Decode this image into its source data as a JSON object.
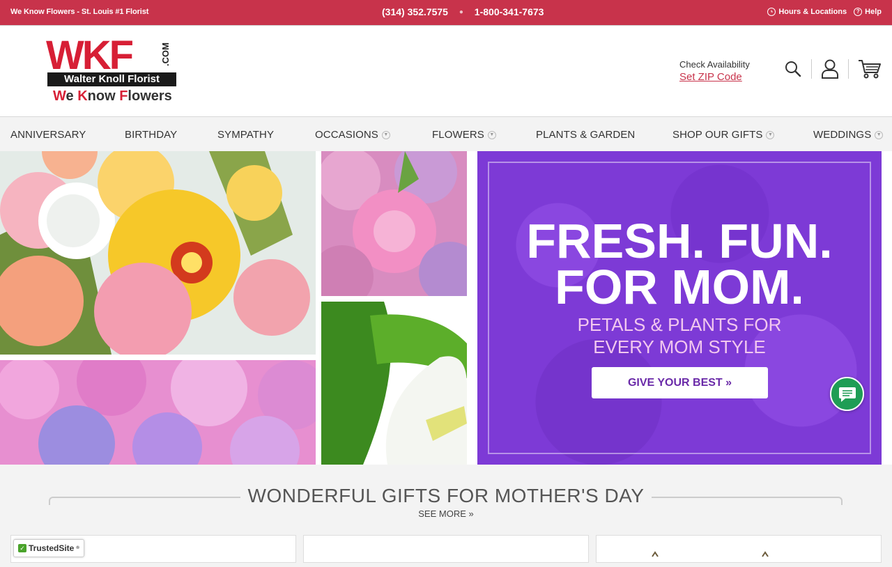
{
  "topbar": {
    "tagline": "We Know Flowers - St. Louis #1 Florist",
    "phone_local": "(314) 352.7575",
    "phone_toll": "1-800-341-7673",
    "hours_label": "Hours & Locations",
    "help_label": "Help"
  },
  "logo": {
    "letters": "WKF",
    "com": ".COM",
    "name": "Walter Knoll Florist",
    "slogan_parts": [
      "W",
      "e ",
      "K",
      "now ",
      "F",
      "lowers"
    ]
  },
  "header": {
    "check_label": "Check Availability",
    "zip_label": "Set ZIP Code",
    "icons": [
      "search-icon",
      "user-icon",
      "cart-icon"
    ]
  },
  "nav": {
    "items": [
      {
        "label": "ANNIVERSARY",
        "dropdown": false
      },
      {
        "label": "BIRTHDAY",
        "dropdown": false
      },
      {
        "label": "SYMPATHY",
        "dropdown": false
      },
      {
        "label": "OCCASIONS",
        "dropdown": true
      },
      {
        "label": "FLOWERS",
        "dropdown": true
      },
      {
        "label": "PLANTS & GARDEN",
        "dropdown": false
      },
      {
        "label": "SHOP OUR GIFTS",
        "dropdown": true
      },
      {
        "label": "WEDDINGS",
        "dropdown": true
      }
    ]
  },
  "promo": {
    "headline_1": "FRESH. FUN.",
    "headline_2": "FOR MOM.",
    "sub_1": "PETALS & PLANTS FOR",
    "sub_2": "EVERY MOM STYLE",
    "cta": "GIVE YOUR BEST »",
    "bg_color": "#7d3ad6"
  },
  "section": {
    "title": "WONDERFUL GIFTS FOR MOTHER'S DAY",
    "see_more": "SEE MORE »"
  },
  "badge": {
    "text": "TrustedSite"
  },
  "colors": {
    "brand_red": "#c8334b",
    "promo_purple": "#7d3ad6",
    "chat_green": "#1f9d55"
  }
}
